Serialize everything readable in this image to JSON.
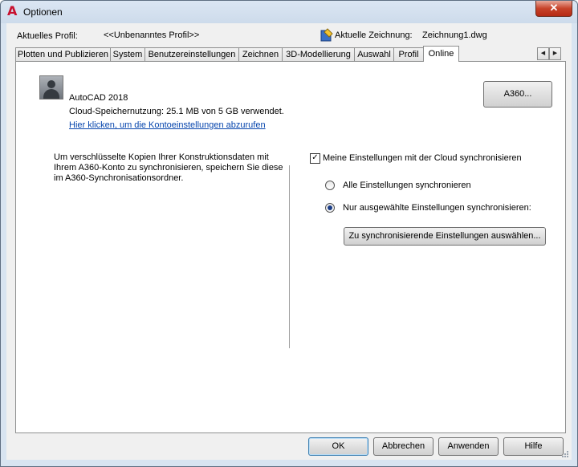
{
  "window": {
    "title": "Optionen",
    "close_glyph": "✕"
  },
  "header": {
    "profile_label": "Aktuelles Profil:",
    "profile_value": "<<Unbenanntes Profil>>",
    "drawing_label": "Aktuelle Zeichnung:",
    "drawing_value": "Zeichnung1.dwg"
  },
  "tabs": [
    {
      "label": "Plotten und Publizieren"
    },
    {
      "label": "System"
    },
    {
      "label": "Benutzereinstellungen"
    },
    {
      "label": "Zeichnen"
    },
    {
      "label": "3D-Modellierung"
    },
    {
      "label": "Auswahl"
    },
    {
      "label": "Profil"
    },
    {
      "label": "Online",
      "active": true
    }
  ],
  "tab_scroll": {
    "left": "◀",
    "right": "▶"
  },
  "online": {
    "product": "AutoCAD 2018",
    "usage": "Cloud-Speichernutzung: 25.1 MB von 5 GB verwendet.",
    "account_link": "Hier klicken, um die Kontoeinstellungen abzurufen",
    "a360_button": "A360...",
    "info_text": "Um verschlüsselte Kopien Ihrer Konstruktionsdaten mit Ihrem A360-Konto zu synchronisieren, speichern Sie diese im A360-Synchronisationsordner.",
    "sync_checkbox": {
      "label": "Meine Einstellungen mit der Cloud synchronisieren",
      "checked": true,
      "check_glyph": "✓"
    },
    "radio_all": {
      "label": "Alle Einstellungen synchronieren",
      "checked": false
    },
    "radio_selected": {
      "label": "Nur ausgewählte Einstellungen synchronisieren:",
      "checked": true
    },
    "choose_button": "Zu synchronisierende Einstellungen auswählen..."
  },
  "footer": {
    "ok": "OK",
    "cancel": "Abbrechen",
    "apply": "Anwenden",
    "help": "Hilfe"
  },
  "colors": {
    "link": "#0645ad",
    "brand": "#c8102e"
  }
}
